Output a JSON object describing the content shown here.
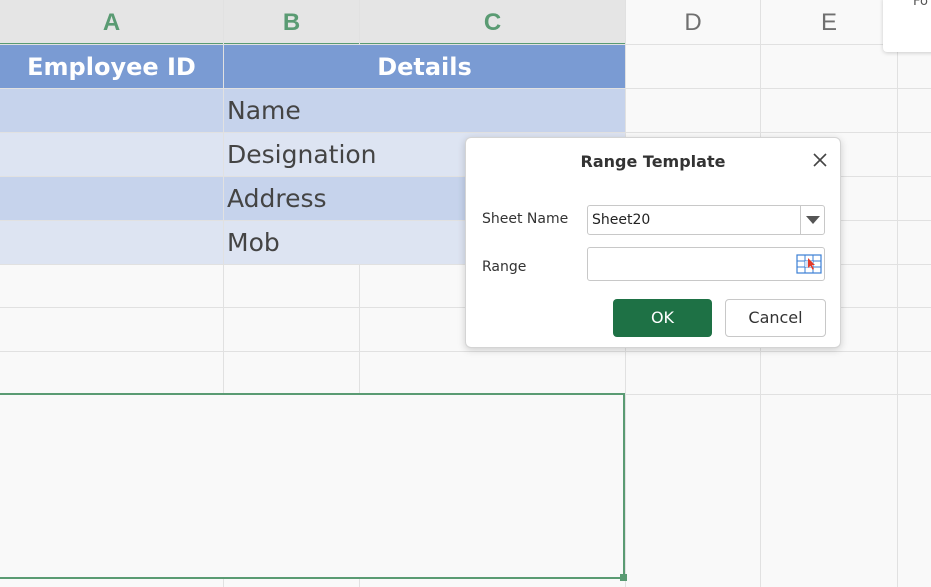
{
  "columns": [
    "A",
    "B",
    "C",
    "D",
    "E"
  ],
  "table": {
    "header": {
      "employee_id": "Employee ID",
      "details": "Details"
    },
    "rows": [
      "Name",
      "Designation",
      "Address",
      "Mob"
    ]
  },
  "corner_panel": {
    "text": "Fo"
  },
  "dialog": {
    "title": "Range Template",
    "close_icon": "close-icon",
    "sheet_name_label": "Sheet Name",
    "sheet_name_value": "Sheet20",
    "range_label": "Range",
    "range_value": "",
    "ok_label": "OK",
    "cancel_label": "Cancel"
  },
  "colors": {
    "accent": "#1e7145",
    "selection": "#5a9b73",
    "table_header": "#7a9bd3",
    "row_band_1": "#c6d3ec",
    "row_band_2": "#dde4f2"
  }
}
